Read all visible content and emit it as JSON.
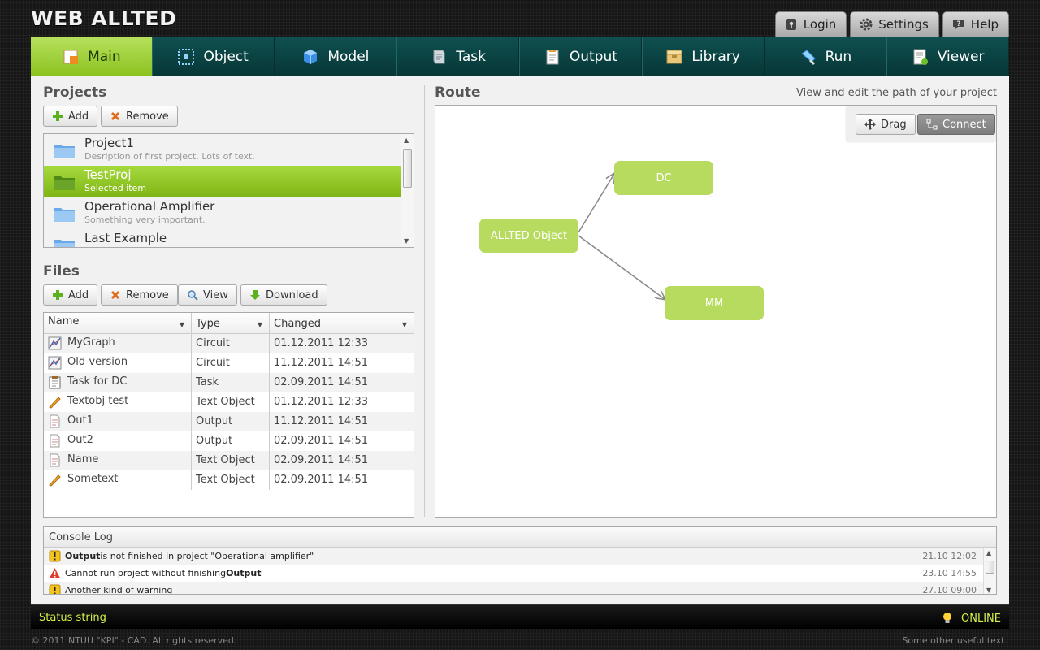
{
  "app": {
    "title": "WEB ALLTED"
  },
  "top_buttons": [
    {
      "label": "Login",
      "icon": "lock-icon"
    },
    {
      "label": "Settings",
      "icon": "gear-icon"
    },
    {
      "label": "Help",
      "icon": "help-icon"
    }
  ],
  "nav": {
    "tabs": [
      {
        "label": "Main",
        "icon": "main-icon",
        "active": true
      },
      {
        "label": "Object",
        "icon": "object-icon"
      },
      {
        "label": "Model",
        "icon": "model-icon"
      },
      {
        "label": "Task",
        "icon": "task-icon"
      },
      {
        "label": "Output",
        "icon": "output-icon"
      },
      {
        "label": "Library",
        "icon": "library-icon"
      },
      {
        "label": "Run",
        "icon": "run-icon"
      },
      {
        "label": "Viewer",
        "icon": "viewer-icon"
      }
    ]
  },
  "projects": {
    "title": "Projects",
    "add_label": "Add",
    "remove_label": "Remove",
    "items": [
      {
        "name": "Project1",
        "description": "Desription of first project. Lots of text."
      },
      {
        "name": "TestProj",
        "description": "Selected item",
        "selected": true
      },
      {
        "name": "Operational Amplifier",
        "description": "Something very important."
      },
      {
        "name": "Last Example",
        "description": ""
      }
    ]
  },
  "files": {
    "title": "Files",
    "add_label": "Add",
    "remove_label": "Remove",
    "view_label": "View",
    "download_label": "Download",
    "columns": [
      "Name",
      "Type",
      "Changed"
    ],
    "rows": [
      {
        "name": "MyGraph",
        "type": "Circuit",
        "changed": "01.12.2011 12:33",
        "icon": "circuit-icon"
      },
      {
        "name": "Old-version",
        "type": "Circuit",
        "changed": "11.12.2011 14:51",
        "icon": "circuit-icon"
      },
      {
        "name": "Task for DC",
        "type": "Task",
        "changed": "02.09.2011 14:51",
        "icon": "task-file-icon"
      },
      {
        "name": "Textobj test",
        "type": "Text Object",
        "changed": "01.12.2011 12:33",
        "icon": "pencil-icon"
      },
      {
        "name": "Out1",
        "type": "Output",
        "changed": "11.12.2011 14:51",
        "icon": "output-file-icon"
      },
      {
        "name": "Out2",
        "type": "Output",
        "changed": "02.09.2011 14:51",
        "icon": "output-file-icon"
      },
      {
        "name": "Name",
        "type": "Text Object",
        "changed": "02.09.2011 14:51",
        "icon": "output-file-icon"
      },
      {
        "name": "Sometext",
        "type": "Text Object",
        "changed": "02.09.2011 14:51",
        "icon": "pencil-icon"
      }
    ]
  },
  "route": {
    "title": "Route",
    "hint": "View and edit the path of your project",
    "drag_label": "Drag",
    "connect_label": "Connect",
    "nodes": {
      "object": "ALLTED Object",
      "dc": "DC",
      "mm": "MM"
    }
  },
  "console": {
    "title": "Console Log",
    "entries": [
      {
        "level": "warning",
        "bold": "Output",
        "text": " is not finished in project \"Operational amplifier\"",
        "time": "21.10 12:02"
      },
      {
        "level": "error",
        "prefix": "Cannot run project without finishing ",
        "bold": "Output",
        "time": "23.10 14:55"
      },
      {
        "level": "warning",
        "text": "Another kind of warning",
        "time": "27.10 09:00"
      }
    ]
  },
  "status": {
    "left": "Status string",
    "right": "ONLINE"
  },
  "footer": {
    "left": "© 2011 NTUU \"KPI\" - CAD. All rights reserved.",
    "right": "Some other useful text."
  },
  "colors": {
    "accent_green": "#8bc21f",
    "nav_teal": "#0b4444",
    "node_green": "#b7db5f",
    "status_yellow": "#d4f04a"
  }
}
